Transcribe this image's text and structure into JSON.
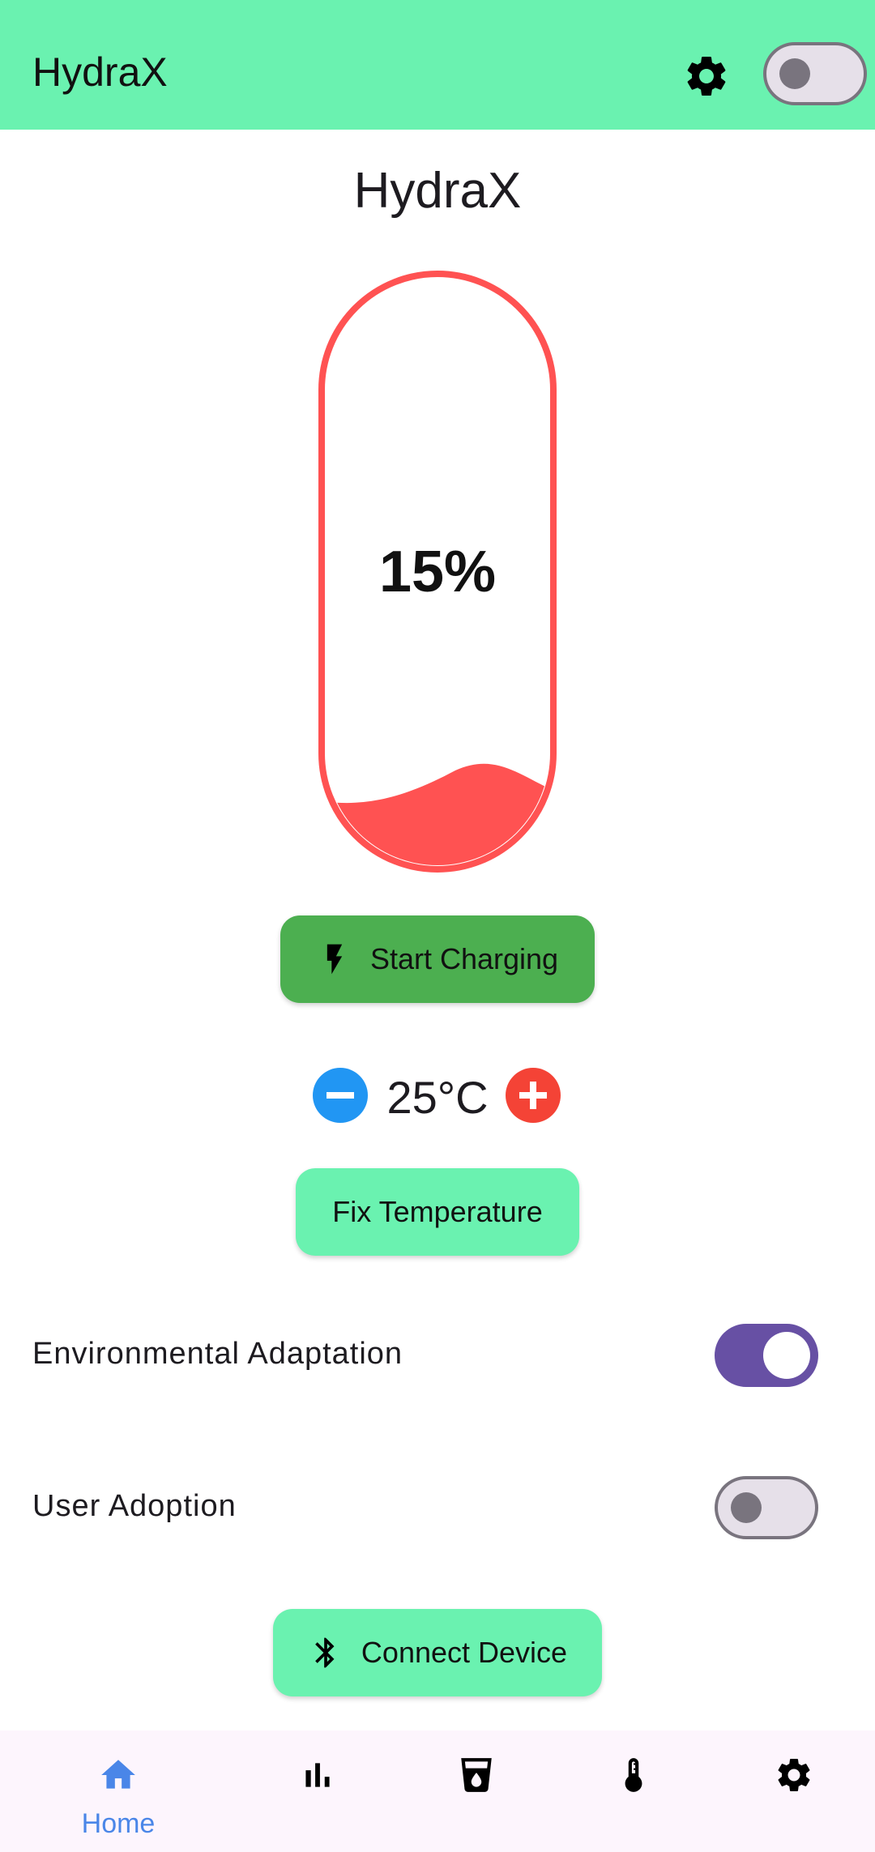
{
  "app": {
    "title": "HydraX",
    "header_toggle_on": false,
    "icons": {
      "settings": "gear-icon"
    }
  },
  "main": {
    "title": "HydraX",
    "battery": {
      "percent_label": "15%",
      "level": 0.15,
      "color": "#ff5252"
    },
    "charge_button": {
      "label": "Start Charging",
      "icon": "bolt-icon",
      "color": "#4caf50"
    },
    "temperature": {
      "value": "25°C",
      "minus_icon": "minus-icon",
      "plus_icon": "plus-icon",
      "minus_color": "#2196f3",
      "plus_color": "#f44336"
    },
    "fix_button": {
      "label": "Fix Temperature",
      "color": "#6af2b0"
    },
    "settings": [
      {
        "label": "Environmental Adaptation",
        "on": true
      },
      {
        "label": "User Adoption",
        "on": false
      }
    ],
    "connect_button": {
      "label": "Connect Device",
      "icon": "bluetooth-icon"
    }
  },
  "nav": {
    "items": [
      {
        "label": "Home",
        "icon": "home-icon",
        "active": true
      },
      {
        "label": "",
        "icon": "bar-chart-icon",
        "active": false
      },
      {
        "label": "",
        "icon": "water-glass-icon",
        "active": false
      },
      {
        "label": "",
        "icon": "thermometer-icon",
        "active": false
      },
      {
        "label": "",
        "icon": "gear-icon",
        "active": false
      }
    ],
    "active_color": "#4a86e8"
  }
}
